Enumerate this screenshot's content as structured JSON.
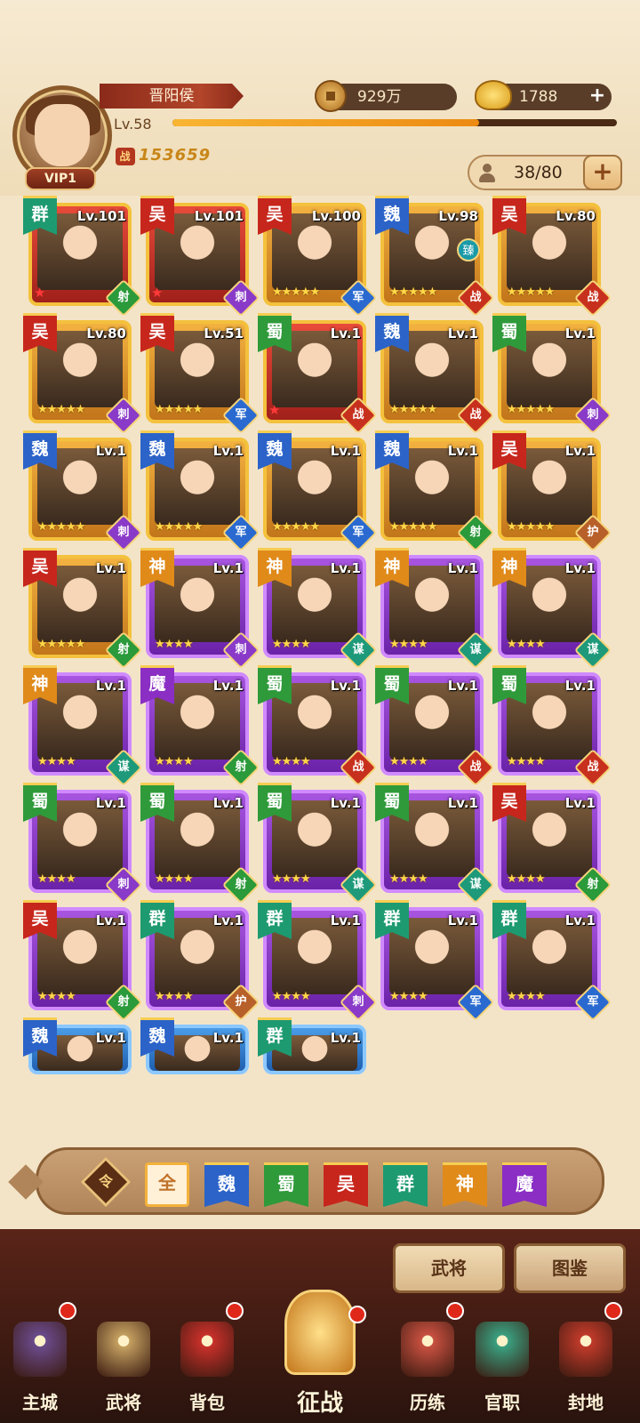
{
  "player": {
    "name": "晋阳侯",
    "vip": "VIP1",
    "level": "Lv.58",
    "exp_fraction": 0.69,
    "power": "153659",
    "power_icon": "战"
  },
  "resources": {
    "copper": "929万",
    "ingot": "1788"
  },
  "capacity": "38/80",
  "heroes": [
    {
      "faction": "群",
      "fclass": "f-qun",
      "lv": "Lv.101",
      "frame": "red",
      "stars": "",
      "role": "射",
      "rclass": "role-she",
      "ex": true
    },
    {
      "faction": "吴",
      "fclass": "f-wu",
      "lv": "Lv.101",
      "frame": "red",
      "stars": "",
      "role": "刺",
      "rclass": "role-ci",
      "ex": true
    },
    {
      "faction": "吴",
      "fclass": "f-wu",
      "lv": "Lv.100",
      "frame": "gold",
      "stars": "★★★★★",
      "role": "军",
      "rclass": "role-jun",
      "ex": false
    },
    {
      "faction": "魏",
      "fclass": "f-wei",
      "lv": "Lv.98",
      "frame": "gold",
      "stars": "★★★★★",
      "role": "战",
      "rclass": "role-zhan",
      "ex": false,
      "extra": "臻"
    },
    {
      "faction": "吴",
      "fclass": "f-wu",
      "lv": "Lv.80",
      "frame": "gold",
      "stars": "★★★★★",
      "role": "战",
      "rclass": "role-zhan",
      "ex": false
    },
    {
      "faction": "吴",
      "fclass": "f-wu",
      "lv": "Lv.80",
      "frame": "gold",
      "stars": "★★★★★",
      "role": "刺",
      "rclass": "role-ci",
      "ex": false
    },
    {
      "faction": "吴",
      "fclass": "f-wu",
      "lv": "Lv.51",
      "frame": "gold",
      "stars": "★★★★★",
      "role": "军",
      "rclass": "role-jun",
      "ex": false
    },
    {
      "faction": "蜀",
      "fclass": "f-shu",
      "lv": "Lv.1",
      "frame": "red",
      "stars": "",
      "role": "战",
      "rclass": "role-zhan",
      "ex": true
    },
    {
      "faction": "魏",
      "fclass": "f-wei",
      "lv": "Lv.1",
      "frame": "gold",
      "stars": "★★★★★",
      "role": "战",
      "rclass": "role-zhan",
      "ex": false
    },
    {
      "faction": "蜀",
      "fclass": "f-shu",
      "lv": "Lv.1",
      "frame": "gold",
      "stars": "★★★★★",
      "role": "刺",
      "rclass": "role-ci",
      "ex": false
    },
    {
      "faction": "魏",
      "fclass": "f-wei",
      "lv": "Lv.1",
      "frame": "gold",
      "stars": "★★★★★",
      "role": "刺",
      "rclass": "role-ci",
      "ex": false
    },
    {
      "faction": "魏",
      "fclass": "f-wei",
      "lv": "Lv.1",
      "frame": "gold",
      "stars": "★★★★★",
      "role": "军",
      "rclass": "role-jun",
      "ex": false
    },
    {
      "faction": "魏",
      "fclass": "f-wei",
      "lv": "Lv.1",
      "frame": "gold",
      "stars": "★★★★★",
      "role": "军",
      "rclass": "role-jun",
      "ex": false
    },
    {
      "faction": "魏",
      "fclass": "f-wei",
      "lv": "Lv.1",
      "frame": "gold",
      "stars": "★★★★★",
      "role": "射",
      "rclass": "role-she",
      "ex": false
    },
    {
      "faction": "吴",
      "fclass": "f-wu",
      "lv": "Lv.1",
      "frame": "gold",
      "stars": "★★★★★",
      "role": "护",
      "rclass": "role-hu",
      "ex": false
    },
    {
      "faction": "吴",
      "fclass": "f-wu",
      "lv": "Lv.1",
      "frame": "gold",
      "stars": "★★★★★",
      "role": "射",
      "rclass": "role-she",
      "ex": false
    },
    {
      "faction": "神",
      "fclass": "f-shen",
      "lv": "Lv.1",
      "frame": "purple",
      "stars": "★★★★",
      "role": "刺",
      "rclass": "role-ci",
      "ex": false
    },
    {
      "faction": "神",
      "fclass": "f-shen",
      "lv": "Lv.1",
      "frame": "purple",
      "stars": "★★★★",
      "role": "谋",
      "rclass": "role-mou",
      "ex": false
    },
    {
      "faction": "神",
      "fclass": "f-shen",
      "lv": "Lv.1",
      "frame": "purple",
      "stars": "★★★★",
      "role": "谋",
      "rclass": "role-mou",
      "ex": false
    },
    {
      "faction": "神",
      "fclass": "f-shen",
      "lv": "Lv.1",
      "frame": "purple",
      "stars": "★★★★",
      "role": "谋",
      "rclass": "role-mou",
      "ex": false
    },
    {
      "faction": "神",
      "fclass": "f-shen",
      "lv": "Lv.1",
      "frame": "purple",
      "stars": "★★★★",
      "role": "谋",
      "rclass": "role-mou",
      "ex": false
    },
    {
      "faction": "魔",
      "fclass": "f-mo",
      "lv": "Lv.1",
      "frame": "purple",
      "stars": "★★★★",
      "role": "射",
      "rclass": "role-she",
      "ex": false
    },
    {
      "faction": "蜀",
      "fclass": "f-shu",
      "lv": "Lv.1",
      "frame": "purple",
      "stars": "★★★★",
      "role": "战",
      "rclass": "role-zhan",
      "ex": false
    },
    {
      "faction": "蜀",
      "fclass": "f-shu",
      "lv": "Lv.1",
      "frame": "purple",
      "stars": "★★★★",
      "role": "战",
      "rclass": "role-zhan",
      "ex": false
    },
    {
      "faction": "蜀",
      "fclass": "f-shu",
      "lv": "Lv.1",
      "frame": "purple",
      "stars": "★★★★",
      "role": "战",
      "rclass": "role-zhan",
      "ex": false
    },
    {
      "faction": "蜀",
      "fclass": "f-shu",
      "lv": "Lv.1",
      "frame": "purple",
      "stars": "★★★★",
      "role": "刺",
      "rclass": "role-ci",
      "ex": false
    },
    {
      "faction": "蜀",
      "fclass": "f-shu",
      "lv": "Lv.1",
      "frame": "purple",
      "stars": "★★★★",
      "role": "射",
      "rclass": "role-she",
      "ex": false
    },
    {
      "faction": "蜀",
      "fclass": "f-shu",
      "lv": "Lv.1",
      "frame": "purple",
      "stars": "★★★★",
      "role": "谋",
      "rclass": "role-mou",
      "ex": false
    },
    {
      "faction": "蜀",
      "fclass": "f-shu",
      "lv": "Lv.1",
      "frame": "purple",
      "stars": "★★★★",
      "role": "谋",
      "rclass": "role-mou",
      "ex": false
    },
    {
      "faction": "吴",
      "fclass": "f-wu",
      "lv": "Lv.1",
      "frame": "purple",
      "stars": "★★★★",
      "role": "射",
      "rclass": "role-she",
      "ex": false
    },
    {
      "faction": "吴",
      "fclass": "f-wu",
      "lv": "Lv.1",
      "frame": "purple",
      "stars": "★★★★",
      "role": "射",
      "rclass": "role-she",
      "ex": false
    },
    {
      "faction": "群",
      "fclass": "f-qun",
      "lv": "Lv.1",
      "frame": "purple",
      "stars": "★★★★",
      "role": "护",
      "rclass": "role-hu",
      "ex": false
    },
    {
      "faction": "群",
      "fclass": "f-qun",
      "lv": "Lv.1",
      "frame": "purple",
      "stars": "★★★★",
      "role": "刺",
      "rclass": "role-ci",
      "ex": false
    },
    {
      "faction": "群",
      "fclass": "f-qun",
      "lv": "Lv.1",
      "frame": "purple",
      "stars": "★★★★",
      "role": "军",
      "rclass": "role-jun",
      "ex": false
    },
    {
      "faction": "群",
      "fclass": "f-qun",
      "lv": "Lv.1",
      "frame": "purple",
      "stars": "★★★★",
      "role": "军",
      "rclass": "role-jun",
      "ex": false
    },
    {
      "faction": "魏",
      "fclass": "f-wei",
      "lv": "Lv.1",
      "frame": "blue",
      "stars": "",
      "role": "",
      "rclass": "",
      "ex": false
    },
    {
      "faction": "魏",
      "fclass": "f-wei",
      "lv": "Lv.1",
      "frame": "blue",
      "stars": "",
      "role": "",
      "rclass": "",
      "ex": false
    },
    {
      "faction": "群",
      "fclass": "f-qun",
      "lv": "Lv.1",
      "frame": "blue",
      "stars": "",
      "role": "",
      "rclass": "",
      "ex": false
    }
  ],
  "filters": {
    "sort_icon": "令",
    "items": [
      {
        "label": "全",
        "cls": "all"
      },
      {
        "label": "魏",
        "cls": "f-wei"
      },
      {
        "label": "蜀",
        "cls": "f-shu"
      },
      {
        "label": "吴",
        "cls": "f-wu"
      },
      {
        "label": "群",
        "cls": "f-qun"
      },
      {
        "label": "神",
        "cls": "f-shen"
      },
      {
        "label": "魔",
        "cls": "f-mo"
      }
    ]
  },
  "tabs": {
    "heroes": "武将",
    "codex": "图鉴"
  },
  "nav": [
    {
      "label": "主城",
      "icon": "city-icon",
      "color": "#6a4a8a",
      "dot": true
    },
    {
      "label": "武将",
      "icon": "hero-icon",
      "color": "#c4a060",
      "dot": false
    },
    {
      "label": "背包",
      "icon": "bag-icon",
      "color": "#c8302a",
      "dot": true
    },
    {
      "label": "征战",
      "icon": "battle-icon",
      "color": "#d09030",
      "dot": true
    },
    {
      "label": "历练",
      "icon": "training-icon",
      "color": "#c85040",
      "dot": true
    },
    {
      "label": "官职",
      "icon": "rank-icon",
      "color": "#3aa080",
      "dot": false
    },
    {
      "label": "封地",
      "icon": "fief-icon",
      "color": "#c03a2a",
      "dot": true
    }
  ]
}
